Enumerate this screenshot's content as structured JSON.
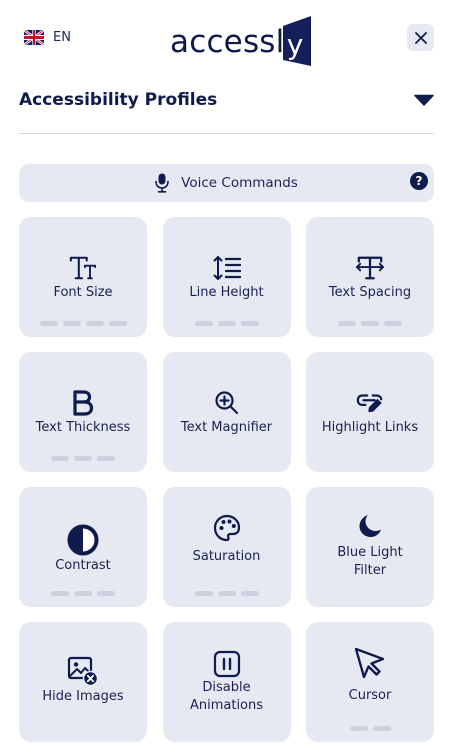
{
  "header": {
    "language_code": "EN",
    "flag_icon": "uk-flag-icon",
    "logo_text": "access",
    "logo_door_letter": "y",
    "close_icon": "close-icon"
  },
  "profiles": {
    "title": "Accessibility Profiles",
    "toggle_icon": "chevron-down-icon"
  },
  "voice": {
    "label": "Voice Commands",
    "icon": "microphone-icon",
    "help_symbol": "?"
  },
  "tiles": [
    {
      "label": "Font Size",
      "icon": "font-size-icon",
      "levels": 4
    },
    {
      "label": "Line Height",
      "icon": "line-height-icon",
      "levels": 3
    },
    {
      "label": "Text Spacing",
      "icon": "text-spacing-icon",
      "levels": 3
    },
    {
      "label": "Text Thickness",
      "icon": "bold-icon",
      "levels": 3
    },
    {
      "label": "Text Magnifier",
      "icon": "magnifier-icon",
      "levels": 0
    },
    {
      "label": "Highlight Links",
      "icon": "link-highlight-icon",
      "levels": 0
    },
    {
      "label": "Contrast",
      "icon": "contrast-icon",
      "levels": 3
    },
    {
      "label": "Saturation",
      "icon": "palette-icon",
      "levels": 3
    },
    {
      "label_line1": "Blue Light",
      "label_line2": "Filter",
      "icon": "moon-icon",
      "levels": 0
    },
    {
      "label": "Hide Images",
      "icon": "hide-image-icon",
      "levels": 0
    },
    {
      "label_line1": "Disable",
      "label_line2": "Animations",
      "icon": "pause-icon",
      "levels": 0
    },
    {
      "label": "Cursor",
      "icon": "cursor-icon",
      "levels": 2
    }
  ],
  "colors": {
    "navy": "#0f1a4d",
    "tile_bg": "#e6e8f2",
    "level_dash": "#cdd0de"
  }
}
